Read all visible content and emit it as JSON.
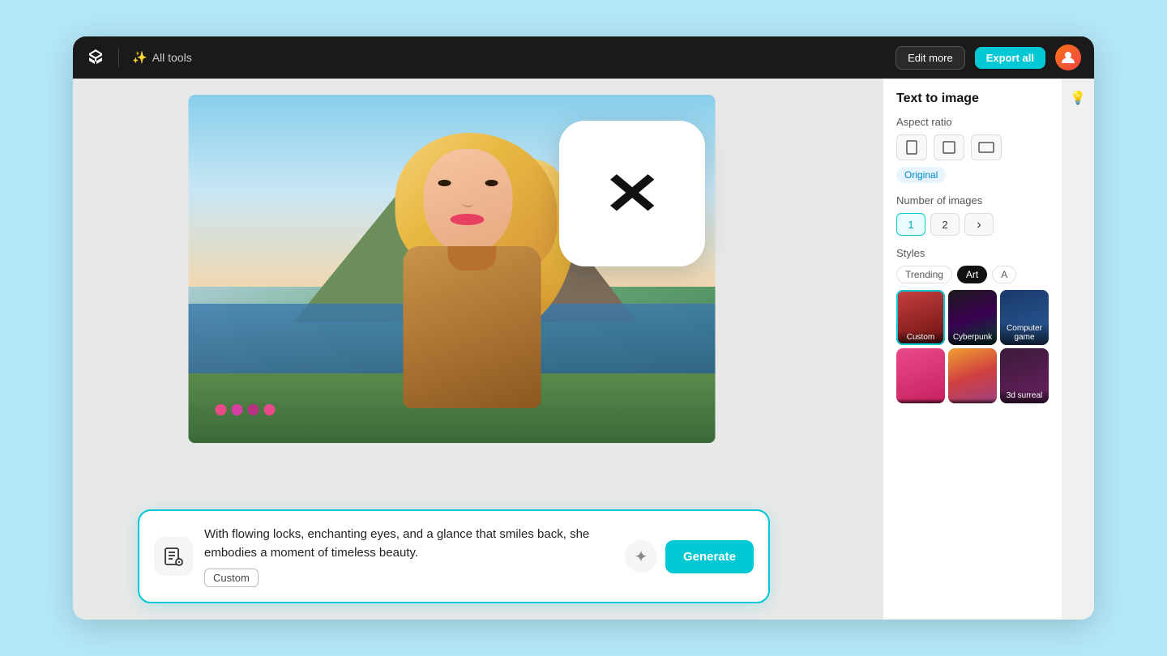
{
  "app": {
    "title": "CapCut",
    "logo_symbol": "✂"
  },
  "nav": {
    "all_tools_label": "All tools",
    "edit_more_label": "Edit more",
    "export_all_label": "Export all",
    "wand_icon": "✨"
  },
  "text_to_image_panel": {
    "title": "Text to image",
    "aspect_ratio_label": "Aspect ratio",
    "original_tag": "Original",
    "num_images_label": "Number of images",
    "num_options": [
      "1",
      "2"
    ],
    "active_num": "1",
    "styles_label": "Styles",
    "style_tabs": [
      "Trending",
      "Art",
      "A"
    ],
    "active_style_tab": "Art",
    "style_items": [
      {
        "name": "Custom",
        "selected": true
      },
      {
        "name": "Cyberpunk",
        "selected": false
      },
      {
        "name": "Computer game",
        "selected": false
      },
      {
        "name": "",
        "selected": false
      },
      {
        "name": "",
        "selected": false
      },
      {
        "name": "3d surreal",
        "selected": false
      }
    ]
  },
  "prompt": {
    "main_text": "With flowing locks, enchanting eyes, and a glance that smiles back, she embodies a moment of timeless beauty.",
    "style_badge": "Custom",
    "generate_label": "Generate",
    "sparkle_icon": "✦"
  },
  "sidebar_right": {
    "lightbulb_icon": "💡"
  }
}
